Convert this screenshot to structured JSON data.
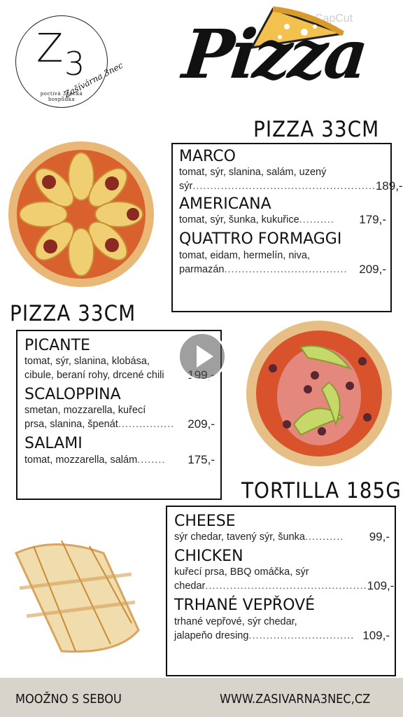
{
  "watermark": "CapCut",
  "logo": {
    "letter": "Z",
    "number": "3",
    "tagline_line1": "poctivá 3necká",
    "tagline_line2": "hospůdka",
    "brand": "Zašívárna 3nec"
  },
  "header": {
    "title": "Pizza"
  },
  "sections": {
    "pizza_top": {
      "heading": "PIZZA 33CM",
      "items": [
        {
          "name": "MARCO",
          "desc_line1": "tomat, sýr, slanina, salám, uzený",
          "desc_line2": "sýr",
          "dots": "....................................................",
          "price": "189,-"
        },
        {
          "name": "AMERICANA",
          "desc_line1": "tomat, sýr, šunka, kukuřice",
          "desc_line2": "",
          "dots": "..........",
          "price": "179,-"
        },
        {
          "name": "QUATTRO FORMAGGI",
          "desc_line1": "tomat, eidam, hermelín, niva,",
          "desc_line2": "parmazán",
          "dots": "...................................",
          "price": "209,-"
        }
      ]
    },
    "pizza_mid": {
      "heading": "PIZZA 33CM",
      "items": [
        {
          "name": "PICANTE",
          "desc_line1": "tomat, sýr, slanina, klobása,",
          "desc_line2": "cibule, beraní rohy, drcené chili",
          "dots": "",
          "price": "199,-"
        },
        {
          "name": "SCALOPPINA",
          "desc_line1": "smetan, mozzarella, kuřecí",
          "desc_line2": "prsa, slanina, špenát",
          "dots": "................",
          "price": "209,-"
        },
        {
          "name": "SALAMI",
          "desc_line1": "tomat, mozzarella, salám",
          "desc_line2": "",
          "dots": "........",
          "price": "175,-"
        }
      ]
    },
    "tortilla": {
      "heading": "TORTILLA 185G",
      "items": [
        {
          "name": "CHEESE",
          "desc_line1": "sýr chedar, tavený sýr, šunka",
          "desc_line2": "",
          "dots": "...........",
          "price": "99,-"
        },
        {
          "name": "CHICKEN",
          "desc_line1": "kuřecí prsa, BBQ omáčka, sýr",
          "desc_line2": "chedar",
          "dots": "..............................................",
          "price": "109,-"
        },
        {
          "name": "TRHANÉ VEPŘOVÉ",
          "desc_line1": "trhané vepřové, sýr chedar,",
          "desc_line2": "jalapeňo dresing",
          "dots": "..............................",
          "price": "109,-"
        }
      ]
    }
  },
  "footer": {
    "left": "MOOŽNO S SEBOU",
    "right": "WWW.ZASIVARNA3NEC,CZ"
  }
}
